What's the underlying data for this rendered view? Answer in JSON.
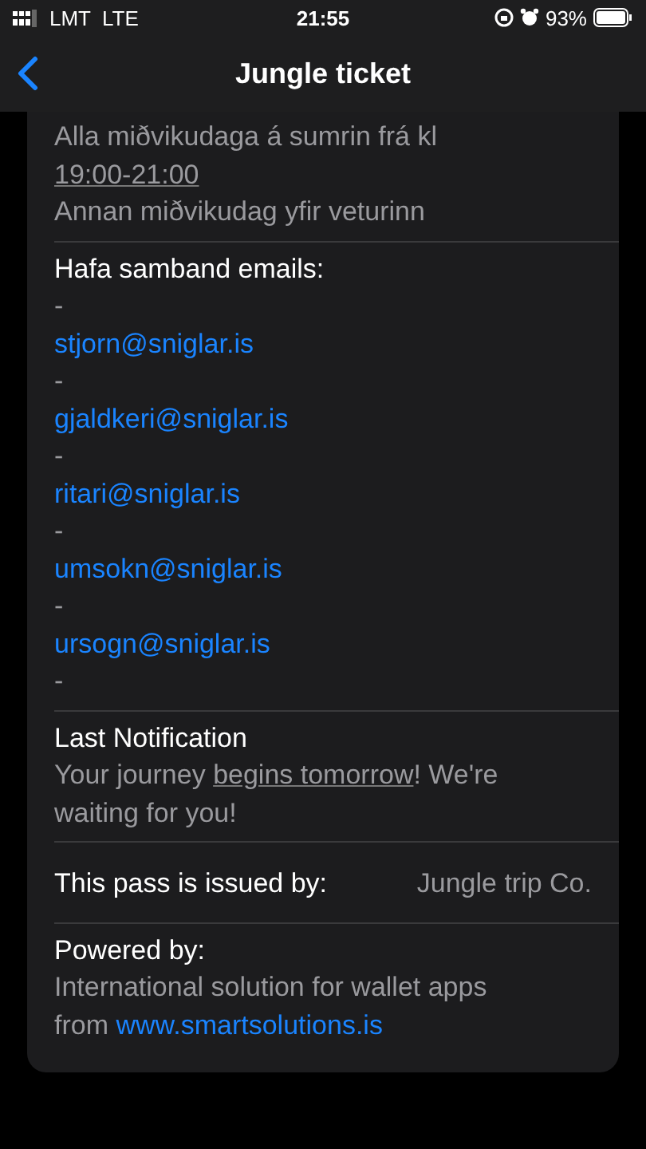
{
  "status_bar": {
    "carrier": "LMT",
    "network": "LTE",
    "time": "21:55",
    "battery": "93%"
  },
  "nav": {
    "title": "Jungle ticket"
  },
  "sections": [
    {
      "kind": "lines",
      "lines": [
        {
          "segments": [
            {
              "text": "Alla miðvikudaga á sumrin frá kl",
              "underlined": false
            }
          ]
        },
        {
          "segments": [
            {
              "text": "19:00-21:00",
              "underlined": true
            }
          ]
        },
        {
          "segments": [
            {
              "text": "Annan miðvikudag yfir veturinn",
              "underlined": false
            }
          ]
        }
      ]
    },
    {
      "kind": "contacts",
      "label": "Hafa samband emails:",
      "lines": [
        {
          "kind": "dash",
          "text": "-"
        },
        {
          "kind": "email",
          "text": "stjorn@sniglar.is"
        },
        {
          "kind": "dash",
          "text": "-"
        },
        {
          "kind": "email",
          "text": "gjaldkeri@sniglar.is"
        },
        {
          "kind": "dash",
          "text": "-"
        },
        {
          "kind": "email",
          "text": "ritari@sniglar.is"
        },
        {
          "kind": "dash",
          "text": "-"
        },
        {
          "kind": "email",
          "text": "umsokn@sniglar.is"
        },
        {
          "kind": "dash",
          "text": "-"
        },
        {
          "kind": "email",
          "text": "ursogn@sniglar.is"
        },
        {
          "kind": "dash",
          "text": "-"
        }
      ]
    },
    {
      "kind": "field",
      "label": "Last Notification",
      "segments": [
        {
          "text": "Your journey ",
          "underlined": false
        },
        {
          "text": "begins tomorrow",
          "underlined": true
        },
        {
          "text": "! We're waiting for you!",
          "underlined": false
        }
      ]
    },
    {
      "kind": "pair",
      "label": "This pass is issued by:",
      "value": "Jungle trip Co."
    },
    {
      "kind": "credit",
      "label": "Powered by:",
      "text": "International solution for wallet apps from",
      "link": "www.smartsolutions.is"
    }
  ]
}
